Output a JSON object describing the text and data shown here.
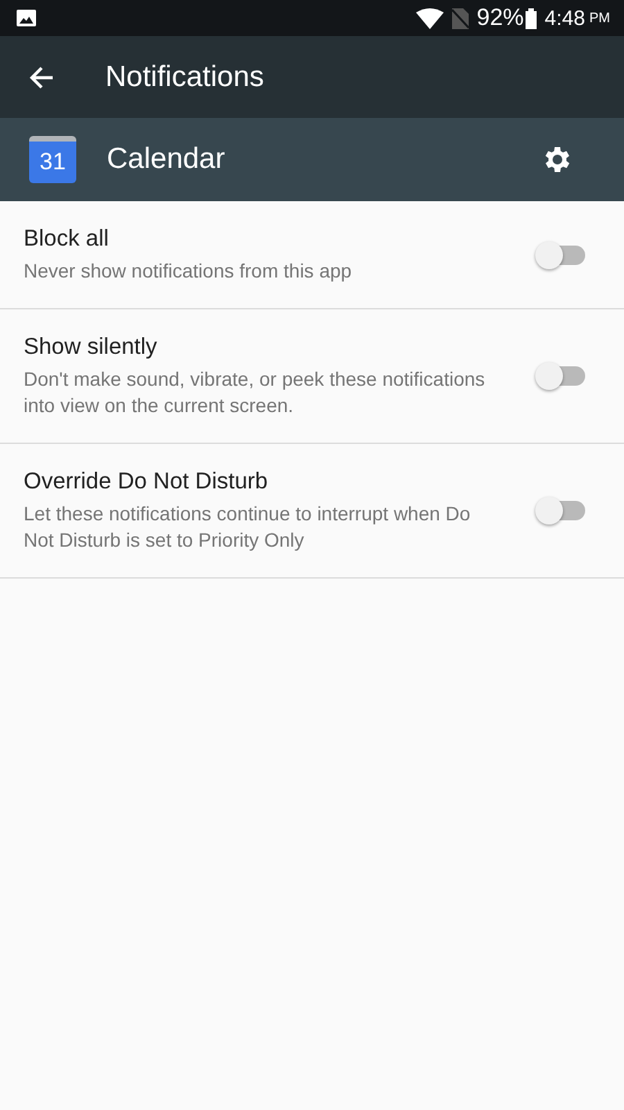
{
  "status_bar": {
    "battery": "92%",
    "time": "4:48",
    "meridiem": "PM"
  },
  "toolbar": {
    "title": "Notifications"
  },
  "app": {
    "icon_text": "31",
    "name": "Calendar"
  },
  "settings": [
    {
      "title": "Block all",
      "summary": "Never show notifications from this app",
      "on": false
    },
    {
      "title": "Show silently",
      "summary": "Don't make sound, vibrate, or peek these notifications into view on the current screen.",
      "on": false
    },
    {
      "title": "Override Do Not Disturb",
      "summary": "Let these notifications continue to interrupt when Do Not Disturb is set to Priority Only",
      "on": false
    }
  ]
}
